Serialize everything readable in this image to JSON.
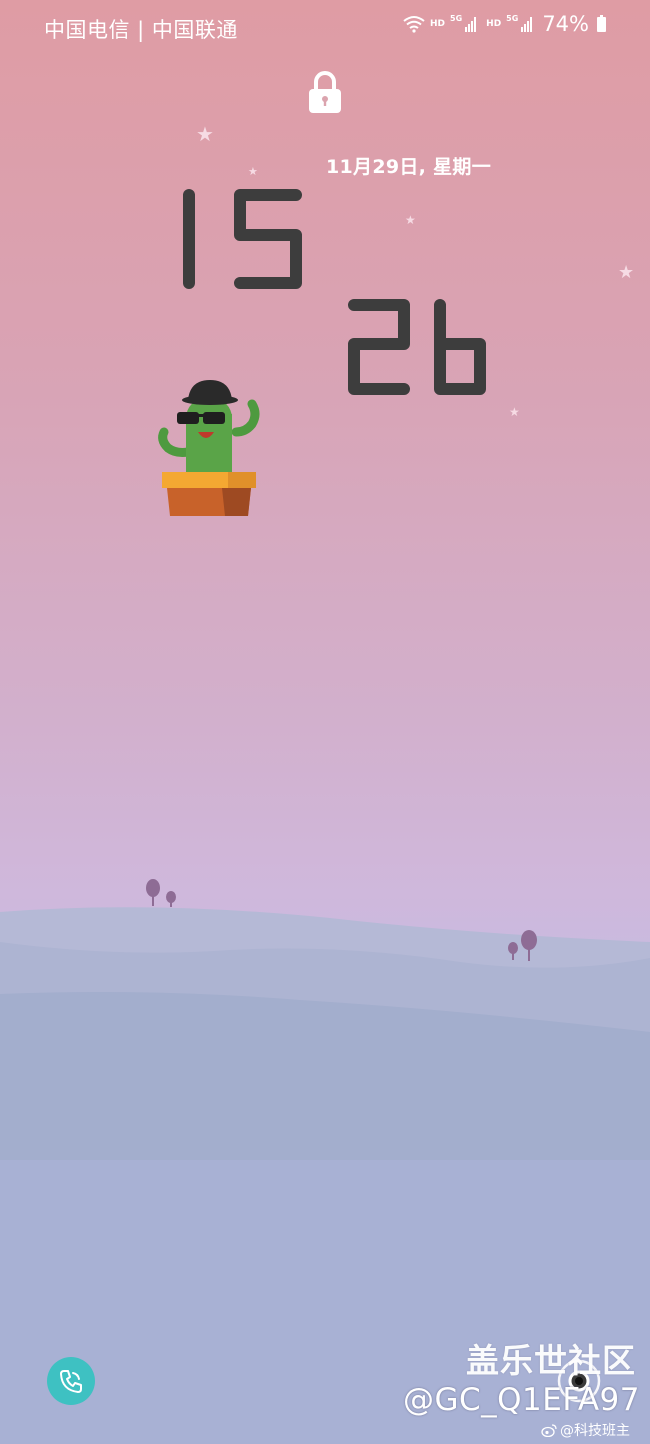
{
  "status_bar": {
    "carrier": "中国电信 | 中国联通",
    "hd_1": "HD",
    "net_1": "5G",
    "hd_2": "HD",
    "net_2": "5G",
    "battery_percent": "74%"
  },
  "lockscreen": {
    "date": "11月29日, 星期一",
    "hours": "15",
    "minutes": "26",
    "clock_color": "#3d3d3d"
  },
  "icons": {
    "lock": "lock-icon",
    "phone": "phone-icon",
    "camera": "camera-icon",
    "wifi": "wifi-icon",
    "signal": "signal-icon",
    "battery": "battery-icon",
    "weibo": "weibo-icon"
  },
  "colors": {
    "phone_button": "#3ec1c2",
    "clock_digits": "#3d3d3d",
    "sky_top": "#df9ca4",
    "hills": "#aab3d2"
  },
  "watermark": {
    "title": "盖乐世社区",
    "user": "@GC_Q1EFA97",
    "credit": "@科技班主"
  }
}
